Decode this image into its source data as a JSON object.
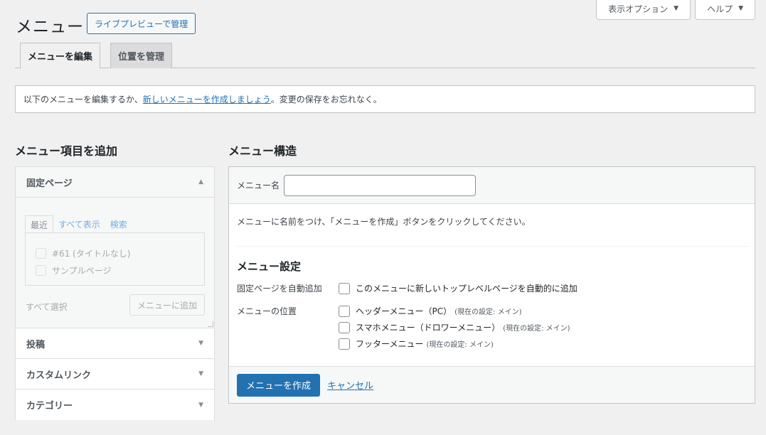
{
  "screen_options": {
    "label": "表示オプション",
    "help_label": "ヘルプ",
    "arrow": "▼"
  },
  "page": {
    "title": "メニュー",
    "live_preview_label": "ライブプレビューで管理"
  },
  "tabs": [
    {
      "label": "メニューを編集",
      "active": true
    },
    {
      "label": "位置を管理",
      "active": false
    }
  ],
  "notice": {
    "prefix": "以下のメニューを編集するか、",
    "link": "新しいメニューを作成しましょう",
    "suffix": "。変更の保存をお忘れなく。"
  },
  "add_items": {
    "title": "メニュー項目を追加",
    "sections": [
      {
        "label": "固定ページ",
        "expanded": true
      },
      {
        "label": "投稿",
        "expanded": false
      },
      {
        "label": "カスタムリンク",
        "expanded": false
      },
      {
        "label": "カテゴリー",
        "expanded": false
      }
    ],
    "pages_tabs": [
      "最近",
      "すべて表示",
      "検索"
    ],
    "pages_list": [
      "#61 (タイトルなし)",
      "サンプルページ"
    ],
    "select_all": "すべて選択",
    "add_button": "メニューに追加",
    "arrow_up": "▲",
    "arrow_down": "▼"
  },
  "structure": {
    "title": "メニュー構造",
    "name_label": "メニュー名",
    "name_value": "",
    "instructions": "メニューに名前をつけ、「メニューを作成」ボタンをクリックしてください。",
    "settings_title": "メニュー設定",
    "auto_add_label": "固定ページを自動追加",
    "auto_add_option": "このメニューに新しいトップレベルページを自動的に追加",
    "location_label": "メニューの位置",
    "locations": [
      {
        "label": "ヘッダーメニュー（PC）",
        "note": "(現在の設定: メイン)"
      },
      {
        "label": "スマホメニュー（ドロワーメニュー）",
        "note": "(現在の設定: メイン)"
      },
      {
        "label": "フッターメニュー",
        "note": "(現在の設定: メイン)"
      }
    ],
    "create_button": "メニューを作成",
    "cancel_link": "キャンセル"
  }
}
